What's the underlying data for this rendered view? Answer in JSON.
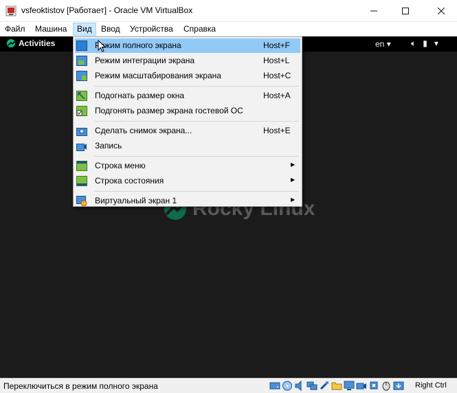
{
  "window": {
    "title": "vsfeoktistov [Работает] - Oracle VM VirtualBox",
    "icon": "virtualbox-icon"
  },
  "menubar": {
    "items": [
      "Файл",
      "Машина",
      "Вид",
      "Ввод",
      "Устройства",
      "Справка"
    ],
    "active": "Вид"
  },
  "guest": {
    "activities": "Activities",
    "language": "en",
    "logo_text": "Rocky Linux"
  },
  "view_menu": {
    "items": [
      {
        "label": "Режим полного экрана",
        "shortcut": "Host+F",
        "icon": "fullscreen-mode-icon",
        "highlighted": true
      },
      {
        "label": "Режим интеграции экрана",
        "shortcut": "Host+L",
        "icon": "seamless-mode-icon"
      },
      {
        "label": "Режим масштабирования экрана",
        "shortcut": "Host+C",
        "icon": "scale-mode-icon"
      },
      {
        "label": "Подогнать размер окна",
        "shortcut": "Host+A",
        "icon": "adjust-window-icon"
      },
      {
        "label": "Подгонять размер экрана гостевой ОС",
        "shortcut": "",
        "icon": "auto-resize-guest-icon"
      },
      {
        "label": "Сделать снимок экрана...",
        "shortcut": "Host+E",
        "icon": "screenshot-icon"
      },
      {
        "label": "Запись",
        "shortcut": "",
        "icon": "record-icon"
      },
      {
        "label": "Строка меню",
        "shortcut": "",
        "icon": "menubar-icon",
        "submenu": true
      },
      {
        "label": "Строка состояния",
        "shortcut": "",
        "icon": "statusbar-icon",
        "submenu": true
      },
      {
        "label": "Виртуальный экран 1",
        "shortcut": "",
        "icon": "virtual-screen-icon",
        "submenu": true
      }
    ]
  },
  "statusbar": {
    "message": "Переключиться в режим полного экрана",
    "host_key": "Right Ctrl",
    "icons": [
      "hard-disk-icon",
      "optical-drive-icon",
      "audio-icon",
      "network-icon",
      "usb-icon",
      "shared-folders-icon",
      "display-icon",
      "video-capture-icon",
      "cpu-icon",
      "mouse-integration-icon",
      "keyboard-capture-icon"
    ]
  },
  "colors": {
    "menu_highlight": "#91c9f7",
    "menubar_active": "#cce8ff",
    "vm_background": "#1b1b1b",
    "rocky_green": "#10b981"
  }
}
